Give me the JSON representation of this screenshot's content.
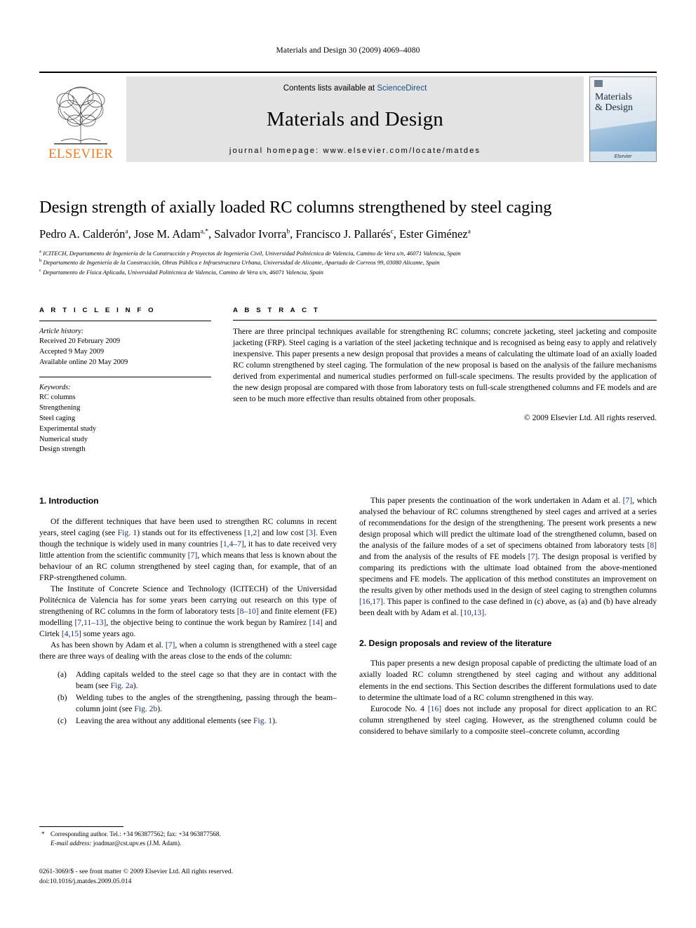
{
  "running_head": "Materials and Design 30 (2009) 4069–4080",
  "masthead": {
    "publisher_name": "ELSEVIER",
    "contents_prefix": "Contents lists available at",
    "contents_link": "ScienceDirect",
    "journal_name": "Materials and Design",
    "homepage_line": "journal homepage: www.elsevier.com/locate/matdes",
    "cover": {
      "line1": "Materials",
      "line2": "& Design",
      "footer_brand": "Elsevier"
    }
  },
  "article": {
    "title": "Design strength of axially loaded RC columns strengthened by steel caging",
    "authors": "Pedro A. Calderón a, Jose M. Adam a,*, Salvador Ivorra b, Francisco J. Pallarés c, Ester Giménez a",
    "affiliations": [
      "a ICITECH, Departamento de Ingeniería de la Construcción y Proyectos de Ingeniería Civil, Universidad Politécnica de Valencia, Camino de Vera s/n, 46071 Valencia, Spain",
      "b Departamento de Ingeniería de la Construcción, Obras Pública e Infraestructura Urbana, Universidad de Alicante, Apartado de Correos 99, 03080 Alicante, Spain",
      "c Departamento de Física Aplicada, Universidad Politécnica de Valencia, Camino de Vera s/n, 46071 Valencia, Spain"
    ]
  },
  "article_info": {
    "heading": "A R T I C L E   I N F O",
    "history_label": "Article history:",
    "history": [
      "Received 20 February 2009",
      "Accepted 9 May 2009",
      "Available online 20 May 2009"
    ],
    "keywords_label": "Keywords:",
    "keywords": [
      "RC columns",
      "Strengthening",
      "Steel caging",
      "Experimental study",
      "Numerical study",
      "Design strength"
    ]
  },
  "abstract": {
    "heading": "A B S T R A C T",
    "text": "There are three principal techniques available for strengthening RC columns; concrete jacketing, steel jacketing and composite jacketing (FRP). Steel caging is a variation of the steel jacketing technique and is recognised as being easy to apply and relatively inexpensive. This paper presents a new design proposal that provides a means of calculating the ultimate load of an axially loaded RC column strengthened by steel caging. The formulation of the new proposal is based on the analysis of the failure mechanisms derived from experimental and numerical studies performed on full-scale specimens. The results provided by the application of the new design proposal are compared with those from laboratory tests on full-scale strengthened columns and FE models and are seen to be much more effective than results obtained from other proposals.",
    "copyright": "© 2009 Elsevier Ltd. All rights reserved."
  },
  "sections": {
    "intro_heading": "1. Introduction",
    "intro_p1_a": "Of the different techniques that have been used to strengthen RC columns in recent years, steel caging (see ",
    "intro_p1_fig1": "Fig. 1",
    "intro_p1_b": ") stands out for its effectiveness ",
    "intro_p1_r12": "[1,2]",
    "intro_p1_c": " and low cost ",
    "intro_p1_r3": "[3]",
    "intro_p1_d": ". Even though the technique is widely used in many countries ",
    "intro_p1_r147": "[1,4–7]",
    "intro_p1_e": ", it has to date received very little attention from the scientific community ",
    "intro_p1_r7": "[7]",
    "intro_p1_f": ", which means that less is known about the behaviour of an RC column strengthened by steel caging than, for example, that of an FRP-strengthened column.",
    "intro_p2_a": "The Institute of Concrete Science and Technology (ICITECH) of the Universidad Politécnica de Valencia has for some years been carrying out research on this type of strengthening of RC columns in the form of laboratory tests ",
    "intro_p2_r810": "[8–10]",
    "intro_p2_b": " and finite element (FE) modelling ",
    "intro_p2_r71113": "[7,11–13]",
    "intro_p2_c": ", the objective being to continue the work begun by Ramírez ",
    "intro_p2_r14": "[14]",
    "intro_p2_d": " and Cirtek ",
    "intro_p2_r415": "[4,15]",
    "intro_p2_e": " some years ago.",
    "intro_p3_a": "As has been shown by Adam et al. ",
    "intro_p3_r7": "[7]",
    "intro_p3_b": ", when a column is strengthened with a steel cage there are three ways of dealing with the areas close to the ends of the column:",
    "list": [
      {
        "mark": "(a)",
        "text_a": "Adding capitals welded to the steel cage so that they are in contact with the beam (see ",
        "link": "Fig. 2a",
        "text_b": ")."
      },
      {
        "mark": "(b)",
        "text_a": "Welding tubes to the angles of the strengthening, passing through the beam–column joint (see ",
        "link": "Fig. 2b",
        "text_b": ")."
      },
      {
        "mark": "(c)",
        "text_a": "Leaving the area without any additional elements (see ",
        "link": "Fig. 1",
        "text_b": ")."
      }
    ],
    "right_p1_a": "This paper presents the continuation of the work undertaken in Adam et al. ",
    "right_p1_r7": "[7]",
    "right_p1_b": ", which analysed the behaviour of RC columns strengthened by steel cages and arrived at a series of recommendations for the design of the strengthening. The present work presents a new design proposal which will predict the ultimate load of the strengthened column, based on the analysis of the failure modes of a set of specimens obtained from laboratory tests ",
    "right_p1_r8": "[8]",
    "right_p1_c": " and from the analysis of the results of FE models ",
    "right_p1_r7b": "[7]",
    "right_p1_d": ". The design proposal is verified by comparing its predictions with the ultimate load obtained from the above-mentioned specimens and FE models. The application of this method constitutes an improvement on the results given by other methods used in the design of steel caging to strengthen columns ",
    "right_p1_r1617": "[16,17]",
    "right_p1_e": ". This paper is confined to the case defined in (c) above, as (a) and (b) have already been dealt with by Adam et al. ",
    "right_p1_r1013": "[10,13]",
    "right_p1_f": ".",
    "sec2_heading": "2. Design proposals and review of the literature",
    "sec2_p1": "This paper presents a new design proposal capable of predicting the ultimate load of an axially loaded RC column strengthened by steel caging and without any additional elements in the end sections. This Section describes the different formulations used to date to determine the ultimate load of a RC column strengthened in this way.",
    "sec2_p2_a": "Eurocode No. 4 ",
    "sec2_p2_r16": "[16]",
    "sec2_p2_b": " does not include any proposal for direct application to an RC column strengthened by steel caging. However, as the strengthened column could be considered to behave similarly to a composite steel–concrete column, according"
  },
  "footnote": {
    "star": "*",
    "corresponding": "Corresponding author. Tel.: +34 963877562; fax: +34 963877568.",
    "email_label": "E-mail address:",
    "email": "joadmar@cst.upv.es",
    "email_owner": "(J.M. Adam)."
  },
  "colophon": {
    "line1": "0261-3069/$ - see front matter © 2009 Elsevier Ltd. All rights reserved.",
    "line2": "doi:10.1016/j.matdes.2009.05.014"
  },
  "colors": {
    "link_blue": "#1a4b8c",
    "ref_blue": "#1a2f7a",
    "elsevier_orange": "#f47b20",
    "banner_gray": "#e3e3e3"
  }
}
